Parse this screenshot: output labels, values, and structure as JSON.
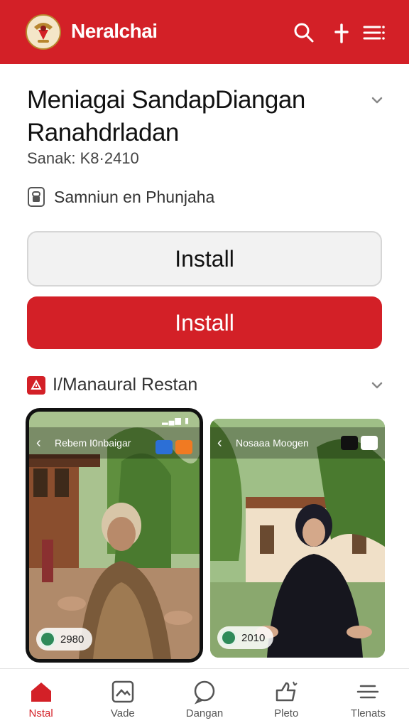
{
  "header": {
    "brand": "Neralchai",
    "icons": [
      "emblem-logo",
      "search-icon",
      "plus-icon",
      "menu-icon"
    ]
  },
  "app": {
    "title_line1": "Meniagai SandapDiangan",
    "title_line2": "Ranahdrladan",
    "subtitle": "Sanak: K8·2410",
    "developer": "Samniun en Phunjaha"
  },
  "buttons": {
    "install_secondary": "Install",
    "install_primary": "Install"
  },
  "section": {
    "title": "I/Manaural Restan"
  },
  "screenshots": [
    {
      "title": "Rebem I0nbaigar",
      "pill": "2980"
    },
    {
      "title": "Nosaaa Moogen",
      "pill": "2010"
    }
  ],
  "nav": [
    {
      "label": "Nstal",
      "icon": "home-icon",
      "active": true
    },
    {
      "label": "Vade",
      "icon": "image-icon",
      "active": false
    },
    {
      "label": "Dangan",
      "icon": "chat-search-icon",
      "active": false
    },
    {
      "label": "Pleto",
      "icon": "thumbs-up-icon",
      "active": false
    },
    {
      "label": "Tlenats",
      "icon": "list-icon",
      "active": false
    }
  ],
  "colors": {
    "brand_red": "#d32027",
    "text_dark": "#111111",
    "button_gray": "#f2f2f2"
  }
}
